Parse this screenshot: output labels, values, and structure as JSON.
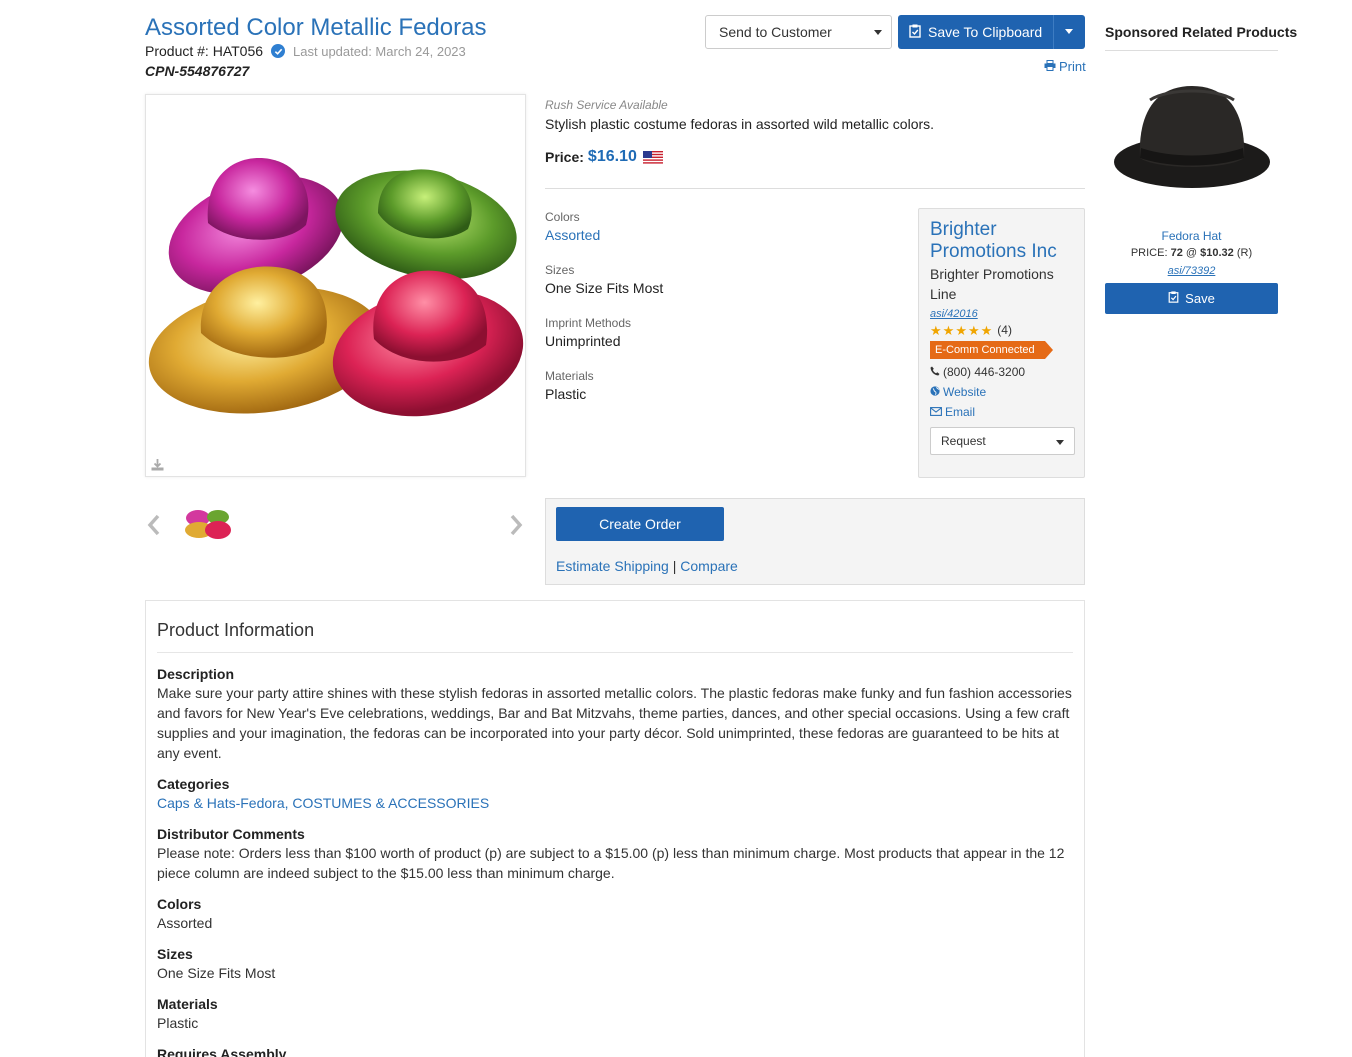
{
  "product": {
    "title": "Assorted Color Metallic Fedoras",
    "product_number": "Product #: HAT056",
    "last_updated": "Last updated: March 24, 2023",
    "cpn": "CPN-554876727",
    "rush": "Rush Service Available",
    "short_description": "Stylish plastic costume fedoras in assorted wild metallic colors.",
    "price_label": "Price:",
    "price_value": "$16.10"
  },
  "actions": {
    "send_to_customer": "Send to Customer",
    "save_to_clipboard": "Save To Clipboard",
    "print": "Print"
  },
  "attributes": [
    {
      "label": "Colors",
      "value": "Assorted"
    },
    {
      "label": "Sizes",
      "value": "One Size Fits Most"
    },
    {
      "label": "Imprint Methods",
      "value": "Unimprinted"
    },
    {
      "label": "Materials",
      "value": "Plastic"
    }
  ],
  "supplier": {
    "name": "Brighter Promotions Inc",
    "line": "Brighter Promotions Line",
    "asi": "asi/42016",
    "rating_count": "(4)",
    "ecomm": "E-Comm Connected",
    "phone": "(800) 446-3200",
    "website": "Website",
    "email": "Email",
    "request": "Request"
  },
  "order": {
    "create_order": "Create Order",
    "estimate_shipping": "Estimate Shipping",
    "separator": "|",
    "compare": "Compare"
  },
  "sponsored": {
    "heading": "Sponsored Related Products",
    "item_name": "Fedora Hat",
    "price_prefix": "PRICE:",
    "price_qty": "72",
    "price_at": "@",
    "price_amount": "$10.32",
    "price_code": "(R)",
    "asi": "asi/73392",
    "save": "Save"
  },
  "info": {
    "heading": "Product Information",
    "sections": [
      {
        "title": "Description",
        "text": "Make sure your party attire shines with these stylish fedoras in assorted metallic colors. The plastic fedoras make funky and fun fashion accessories and favors for New Year's Eve celebrations, weddings, Bar and Bat Mitzvahs, theme parties, dances, and other special occasions. Using a few craft supplies and your imagination, the fedoras can be incorporated into your party décor. Sold unimprinted, these fedoras are guaranteed to be hits at any event."
      },
      {
        "title": "Categories",
        "text": "Caps & Hats-Fedora, COSTUMES & ACCESSORIES"
      },
      {
        "title": "Distributor Comments",
        "text": "Please note: Orders less than $100 worth of product (p) are subject to a $15.00 (p) less than minimum charge. Most products that appear in the 12 piece column are indeed subject to the $15.00 less than minimum charge."
      },
      {
        "title": "Colors",
        "text": "Assorted"
      },
      {
        "title": "Sizes",
        "text": "One Size Fits Most"
      },
      {
        "title": "Materials",
        "text": "Plastic"
      },
      {
        "title": "Requires Assembly",
        "text": ""
      }
    ]
  },
  "colors": {
    "brand_blue": "#1f63b0",
    "link_blue": "#2a72b8",
    "ecomm_orange": "#e56a16",
    "star_gold": "#f0a500"
  }
}
